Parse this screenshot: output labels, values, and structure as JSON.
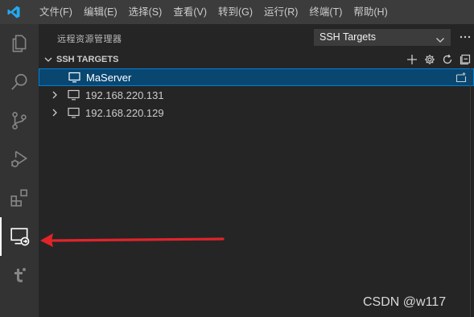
{
  "colors": {
    "titlebar": "#3c3c3c",
    "activitybar": "#333333",
    "sidebar": "#252526",
    "selection": "#094771",
    "selection_border": "#007fd4",
    "logo_blue": "#23a9f2",
    "arrow": "#e1242a"
  },
  "menu": {
    "items": [
      "文件(F)",
      "编辑(E)",
      "选择(S)",
      "查看(V)",
      "转到(G)",
      "运行(R)",
      "终端(T)",
      "帮助(H)"
    ]
  },
  "activitybar": {
    "icons": [
      "explorer-icon",
      "search-icon",
      "source-control-icon",
      "run-debug-icon",
      "extensions-icon",
      "remote-explorer-icon",
      "tomcat-icon"
    ],
    "active": "remote-explorer-icon"
  },
  "sidebar": {
    "title": "远程资源管理器",
    "target_select": "SSH Targets"
  },
  "section": {
    "title": "SSH TARGETS"
  },
  "hosts": [
    {
      "label": "MaServer",
      "selected": true
    },
    {
      "label": "192.168.220.131",
      "selected": false
    },
    {
      "label": "192.168.220.129",
      "selected": false
    }
  ],
  "watermark": "CSDN @w117"
}
